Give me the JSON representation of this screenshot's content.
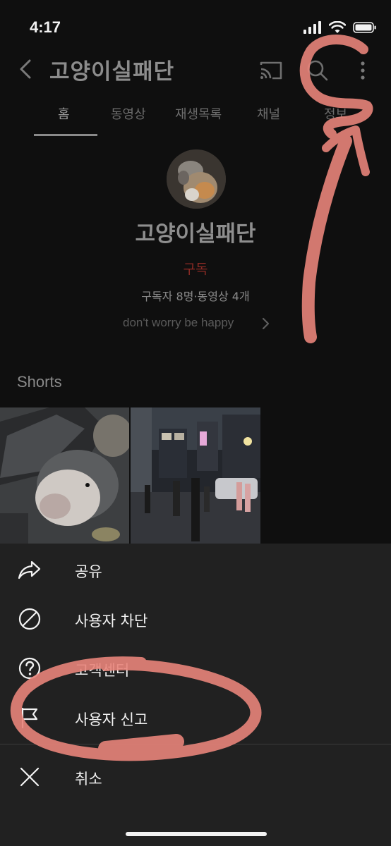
{
  "status_bar": {
    "time": "4:17"
  },
  "header": {
    "title": "고양이실패단"
  },
  "tabs": [
    {
      "label": "홈",
      "active": true
    },
    {
      "label": "동영상",
      "active": false
    },
    {
      "label": "재생목록",
      "active": false
    },
    {
      "label": "채널",
      "active": false
    },
    {
      "label": "정보",
      "active": false
    }
  ],
  "profile": {
    "name": "고양이실패단",
    "subscribe_label": "구독",
    "stats": "구독자 8명·동영상 4개",
    "description": "don't worry be happy"
  },
  "shorts": {
    "heading": "Shorts"
  },
  "menu": {
    "items": [
      {
        "label": "공유",
        "icon": "share-icon"
      },
      {
        "label": "사용자 차단",
        "icon": "block-icon"
      },
      {
        "label": "고객센터",
        "icon": "help-icon"
      },
      {
        "label": "사용자 신고",
        "icon": "flag-icon"
      },
      {
        "label": "취소",
        "icon": "close-icon"
      }
    ]
  },
  "colors": {
    "sheet_background": "#212121",
    "subscribe_red": "#8a2a24",
    "annotation_marker": "#e8847a"
  }
}
